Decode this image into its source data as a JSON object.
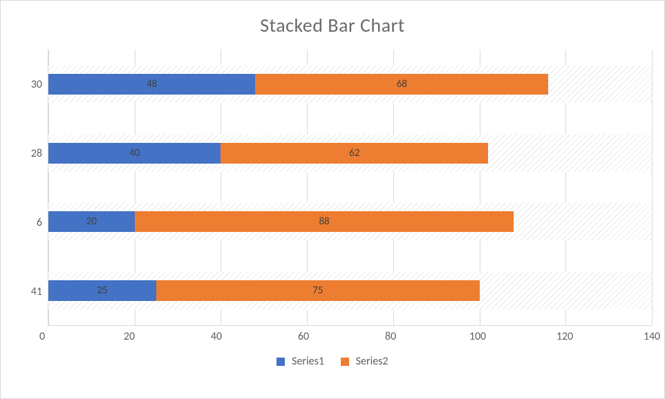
{
  "chart_data": {
    "type": "bar",
    "orientation": "horizontal",
    "stacked": true,
    "title": "Stacked Bar Chart",
    "categories": [
      "41",
      "6",
      "28",
      "30"
    ],
    "series": [
      {
        "name": "Series1",
        "values": [
          25,
          20,
          40,
          48
        ],
        "color": "#4472c4"
      },
      {
        "name": "Series2",
        "values": [
          75,
          88,
          62,
          68
        ],
        "color": "#ed7d31"
      }
    ],
    "xlim": [
      0,
      140
    ],
    "x_ticks": [
      0,
      20,
      40,
      60,
      80,
      100,
      120,
      140
    ],
    "xlabel": "",
    "ylabel": ""
  },
  "legend": {
    "s1": "Series1",
    "s2": "Series2"
  },
  "title": "Stacked Bar Chart",
  "ylab": {
    "r0": "30",
    "r1": "28",
    "r2": "6",
    "r3": "41"
  },
  "xlab": {
    "t0": "0",
    "t1": "20",
    "t2": "40",
    "t3": "60",
    "t4": "80",
    "t5": "100",
    "t6": "120",
    "t7": "140"
  },
  "vals": {
    "r0s1": "48",
    "r0s2": "68",
    "r1s1": "40",
    "r1s2": "62",
    "r2s1": "20",
    "r2s2": "88",
    "r3s1": "25",
    "r3s2": "75"
  }
}
